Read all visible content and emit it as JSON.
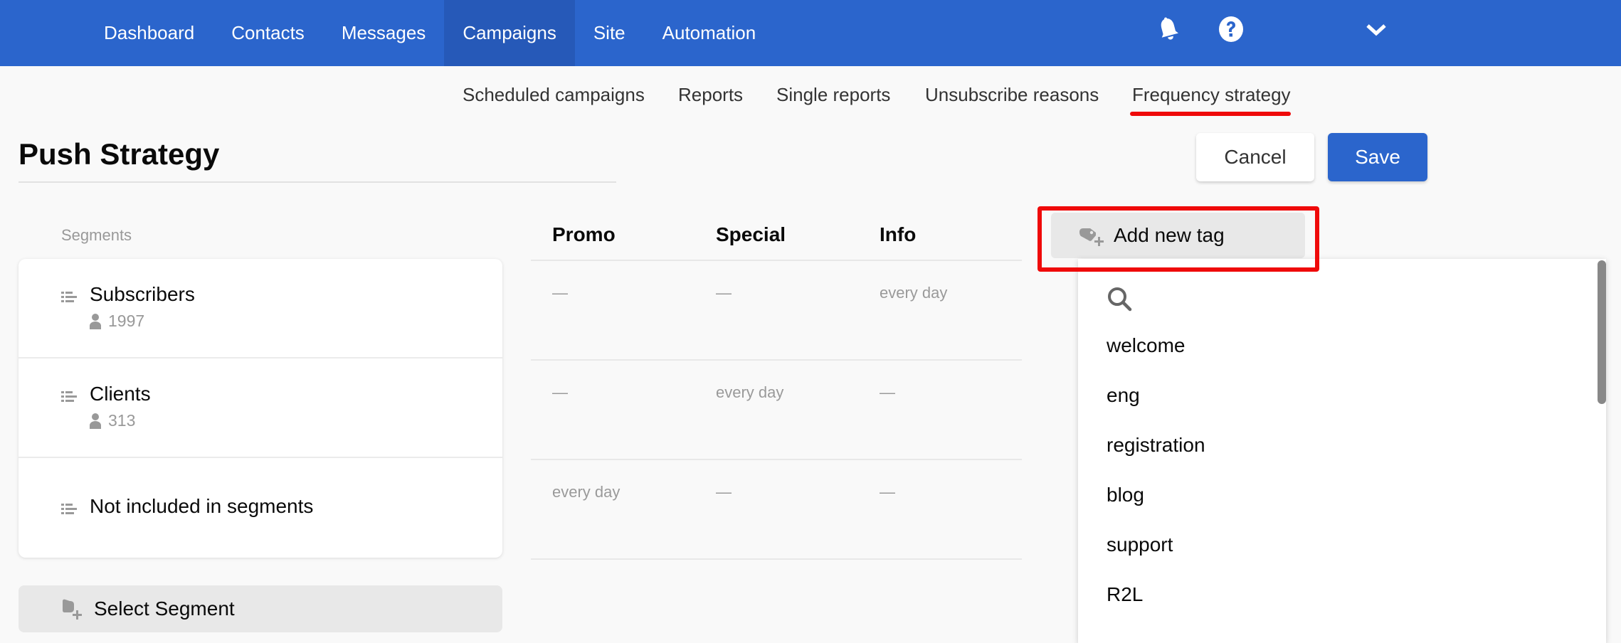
{
  "topnav": {
    "items": [
      {
        "label": "Dashboard"
      },
      {
        "label": "Contacts"
      },
      {
        "label": "Messages"
      },
      {
        "label": "Campaigns",
        "active": true
      },
      {
        "label": "Site"
      },
      {
        "label": "Automation"
      }
    ],
    "icons": [
      "bell-icon",
      "help-icon",
      "chevron-down-icon"
    ]
  },
  "subnav": {
    "items": [
      {
        "label": "Scheduled campaigns"
      },
      {
        "label": "Reports"
      },
      {
        "label": "Single reports"
      },
      {
        "label": "Unsubscribe reasons"
      },
      {
        "label": "Frequency strategy",
        "active": true
      }
    ]
  },
  "page": {
    "title": "Push Strategy",
    "cancel_label": "Cancel",
    "save_label": "Save"
  },
  "segments": {
    "label": "Segments",
    "items": [
      {
        "name": "Subscribers",
        "count": "1997"
      },
      {
        "name": "Clients",
        "count": "313"
      },
      {
        "name": "Not included in segments"
      }
    ],
    "select_label": "Select Segment"
  },
  "frequency": {
    "columns": [
      "Promo",
      "Special",
      "Info"
    ],
    "rows": [
      [
        "—",
        "—",
        "every day"
      ],
      [
        "—",
        "every day",
        "—"
      ],
      [
        "every day",
        "—",
        "—"
      ]
    ]
  },
  "tags": {
    "add_label": "Add new tag",
    "search_placeholder": "",
    "options": [
      "welcome",
      "eng",
      "registration",
      "blog",
      "support",
      "R2L"
    ]
  },
  "colors": {
    "brand": "#2b65cc",
    "nav_active": "#2659b8",
    "highlight": "#ef0a0a"
  }
}
